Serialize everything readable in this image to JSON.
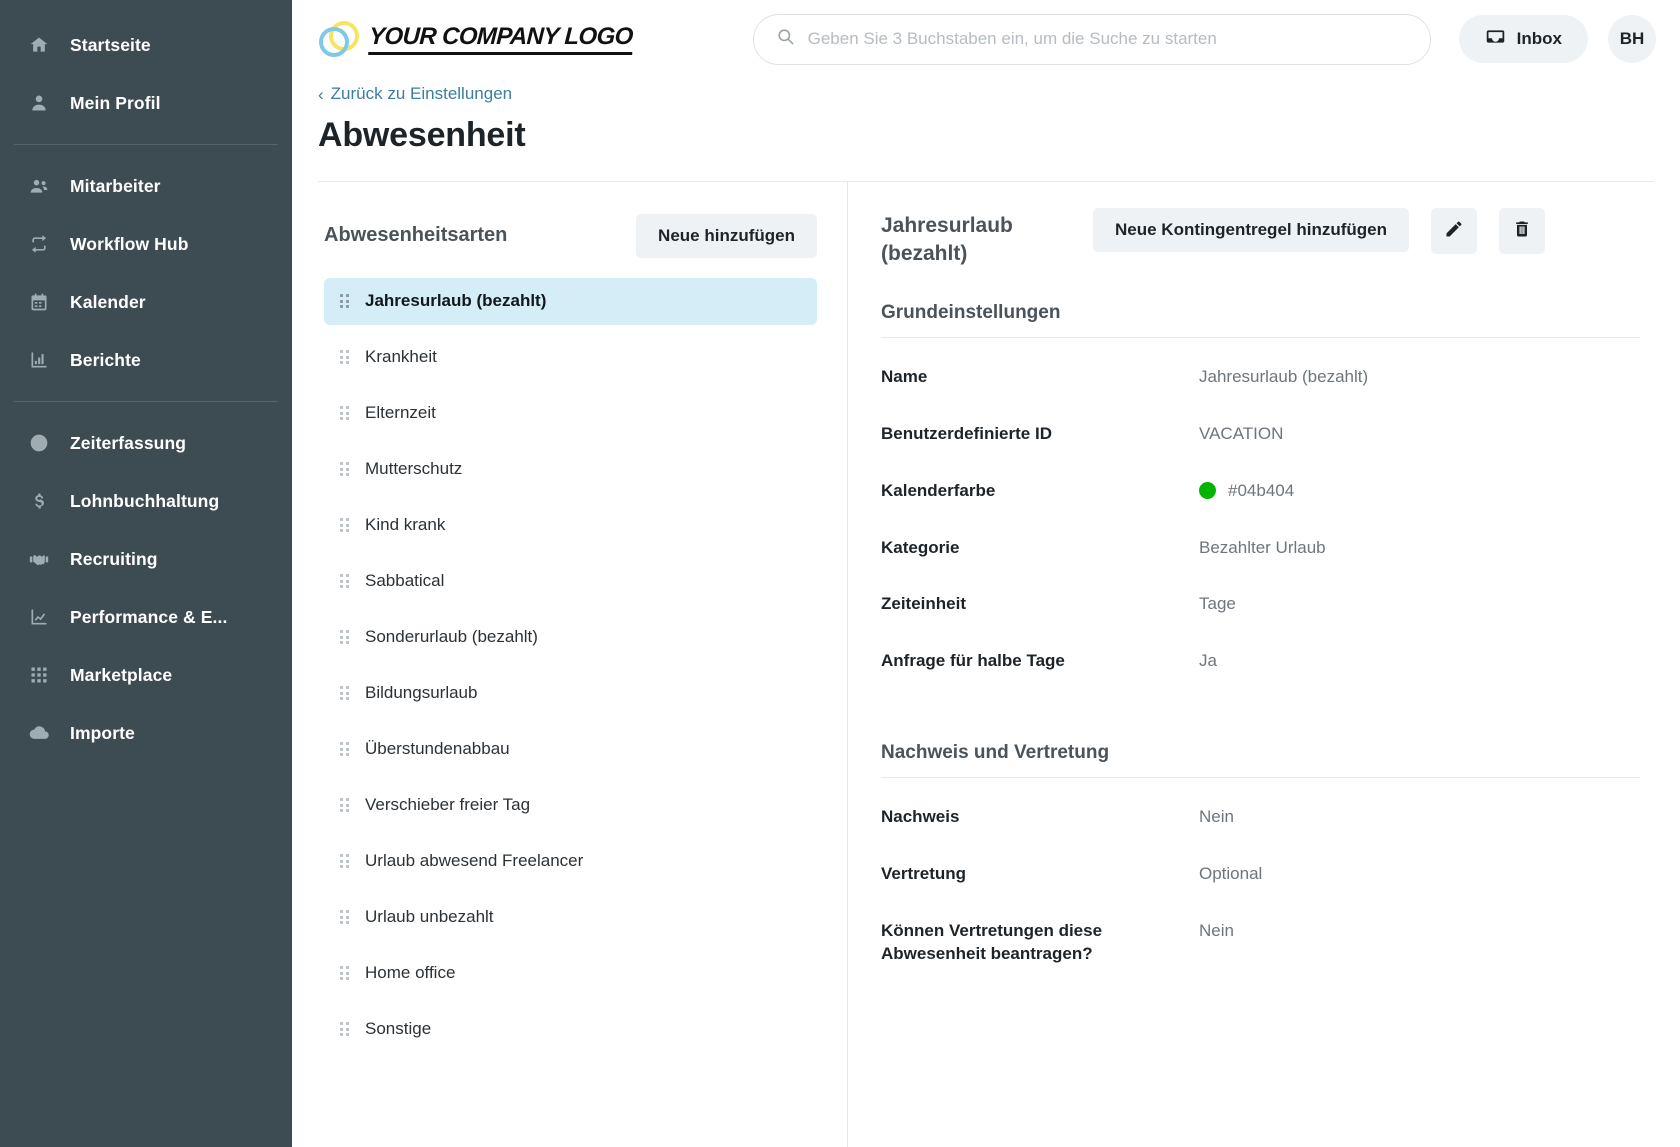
{
  "sidebar": {
    "groups": [
      {
        "items": [
          {
            "label": "Startseite",
            "icon": "home-icon"
          },
          {
            "label": "Mein Profil",
            "icon": "user-icon"
          }
        ]
      },
      {
        "items": [
          {
            "label": "Mitarbeiter",
            "icon": "users-icon"
          },
          {
            "label": "Workflow Hub",
            "icon": "workflow-icon"
          },
          {
            "label": "Kalender",
            "icon": "calendar-icon"
          },
          {
            "label": "Berichte",
            "icon": "bar-chart-icon"
          }
        ]
      },
      {
        "items": [
          {
            "label": "Zeiterfassung",
            "icon": "clock-icon"
          },
          {
            "label": "Lohnbuchhaltung",
            "icon": "dollar-icon"
          },
          {
            "label": "Recruiting",
            "icon": "handshake-icon"
          },
          {
            "label": "Performance & E...",
            "icon": "trend-line-icon"
          },
          {
            "label": "Marketplace",
            "icon": "grid-icon"
          },
          {
            "label": "Importe",
            "icon": "cloud-upload-icon"
          }
        ]
      }
    ]
  },
  "header": {
    "logo_text": "YOUR COMPANY LOGO",
    "search_placeholder": "Geben Sie 3 Buchstaben ein, um die Suche zu starten",
    "search_value": "",
    "inbox_label": "Inbox",
    "avatar_initials": "BH"
  },
  "page": {
    "breadcrumb_chevron": "‹",
    "breadcrumb_label": "Zurück zu Einstellungen",
    "title": "Abwesenheit"
  },
  "list_panel": {
    "heading": "Abwesenheitsarten",
    "add_button": "Neue hinzufügen",
    "items": [
      {
        "label": "Jahresurlaub (bezahlt)",
        "active": true
      },
      {
        "label": "Krankheit",
        "active": false
      },
      {
        "label": "Elternzeit",
        "active": false
      },
      {
        "label": "Mutterschutz",
        "active": false
      },
      {
        "label": "Kind krank",
        "active": false
      },
      {
        "label": "Sabbatical",
        "active": false
      },
      {
        "label": "Sonderurlaub (bezahlt)",
        "active": false
      },
      {
        "label": "Bildungsurlaub",
        "active": false
      },
      {
        "label": "Überstundenabbau",
        "active": false
      },
      {
        "label": "Verschieber freier Tag",
        "active": false
      },
      {
        "label": "Urlaub abwesend Freelancer",
        "active": false
      },
      {
        "label": "Urlaub unbezahlt",
        "active": false
      },
      {
        "label": "Home office",
        "active": false
      },
      {
        "label": "Sonstige",
        "active": false
      }
    ]
  },
  "detail_panel": {
    "title": "Jahresurlaub (bezahlt)",
    "add_quota_button": "Neue Kontingentregel hinzufügen",
    "edit_icon": "pencil-icon",
    "delete_icon": "trash-icon",
    "sections": [
      {
        "title": "Grundeinstellungen",
        "fields": [
          {
            "label": "Name",
            "value": "Jahresurlaub (bezahlt)"
          },
          {
            "label": "Benutzerdefinierte ID",
            "value": "VACATION"
          },
          {
            "label": "Kalenderfarbe",
            "value": "#04b404",
            "swatch": "#04b404"
          },
          {
            "label": "Kategorie",
            "value": "Bezahlter Urlaub"
          },
          {
            "label": "Zeiteinheit",
            "value": "Tage"
          },
          {
            "label": "Anfrage für halbe Tage",
            "value": "Ja"
          }
        ]
      },
      {
        "title": "Nachweis und Vertretung",
        "fields": [
          {
            "label": "Nachweis",
            "value": "Nein"
          },
          {
            "label": "Vertretung",
            "value": "Optional"
          },
          {
            "label": "Können Vertretungen diese Abwesenheit beantragen?",
            "value": "Nein"
          }
        ]
      }
    ]
  },
  "colors": {
    "sidebar_bg": "#3d4b52",
    "accent_link": "#3b7e9e",
    "active_item_bg": "#d4edf6",
    "calendar_color": "#04b404"
  }
}
